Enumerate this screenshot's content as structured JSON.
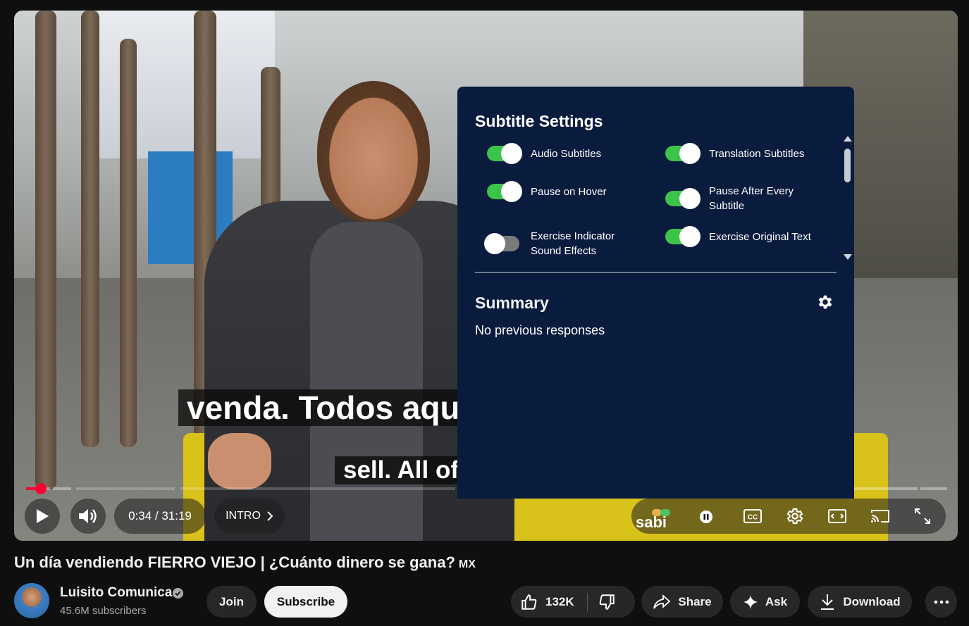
{
  "player": {
    "caption_line1": "venda. Todos aqu",
    "caption_line2": "sell. All of",
    "time_display": "0:34 / 31:19",
    "chapter_label": "INTRO",
    "progress_fraction": 0.018,
    "brand_logo": "sabi"
  },
  "subtitle_settings": {
    "title": "Subtitle Settings",
    "toggles": [
      {
        "label": "Audio Subtitles",
        "on": true
      },
      {
        "label": "Translation Subtitles",
        "on": true
      },
      {
        "label": "Pause on Hover",
        "on": true
      },
      {
        "label": "Pause After Every Subtitle",
        "on": true
      },
      {
        "label": "Exercise Indicator Sound Effects",
        "on": false
      },
      {
        "label": "Exercise Original Text",
        "on": true
      }
    ],
    "summary_title": "Summary",
    "summary_text": "No previous responses"
  },
  "video": {
    "title": "Un día vendiendo FIERRO VIEJO | ¿Cuánto dinero se gana?",
    "title_badge": "MX"
  },
  "channel": {
    "name": "Luisito Comunica",
    "subscribers": "45.6M subscribers"
  },
  "actions": {
    "join": "Join",
    "subscribe": "Subscribe",
    "likes": "132K",
    "share": "Share",
    "ask": "Ask",
    "download": "Download"
  },
  "colors": {
    "accent_red": "#ff0033",
    "panel_bg": "#0a1c3e",
    "toggle_on": "#3cc34a"
  }
}
